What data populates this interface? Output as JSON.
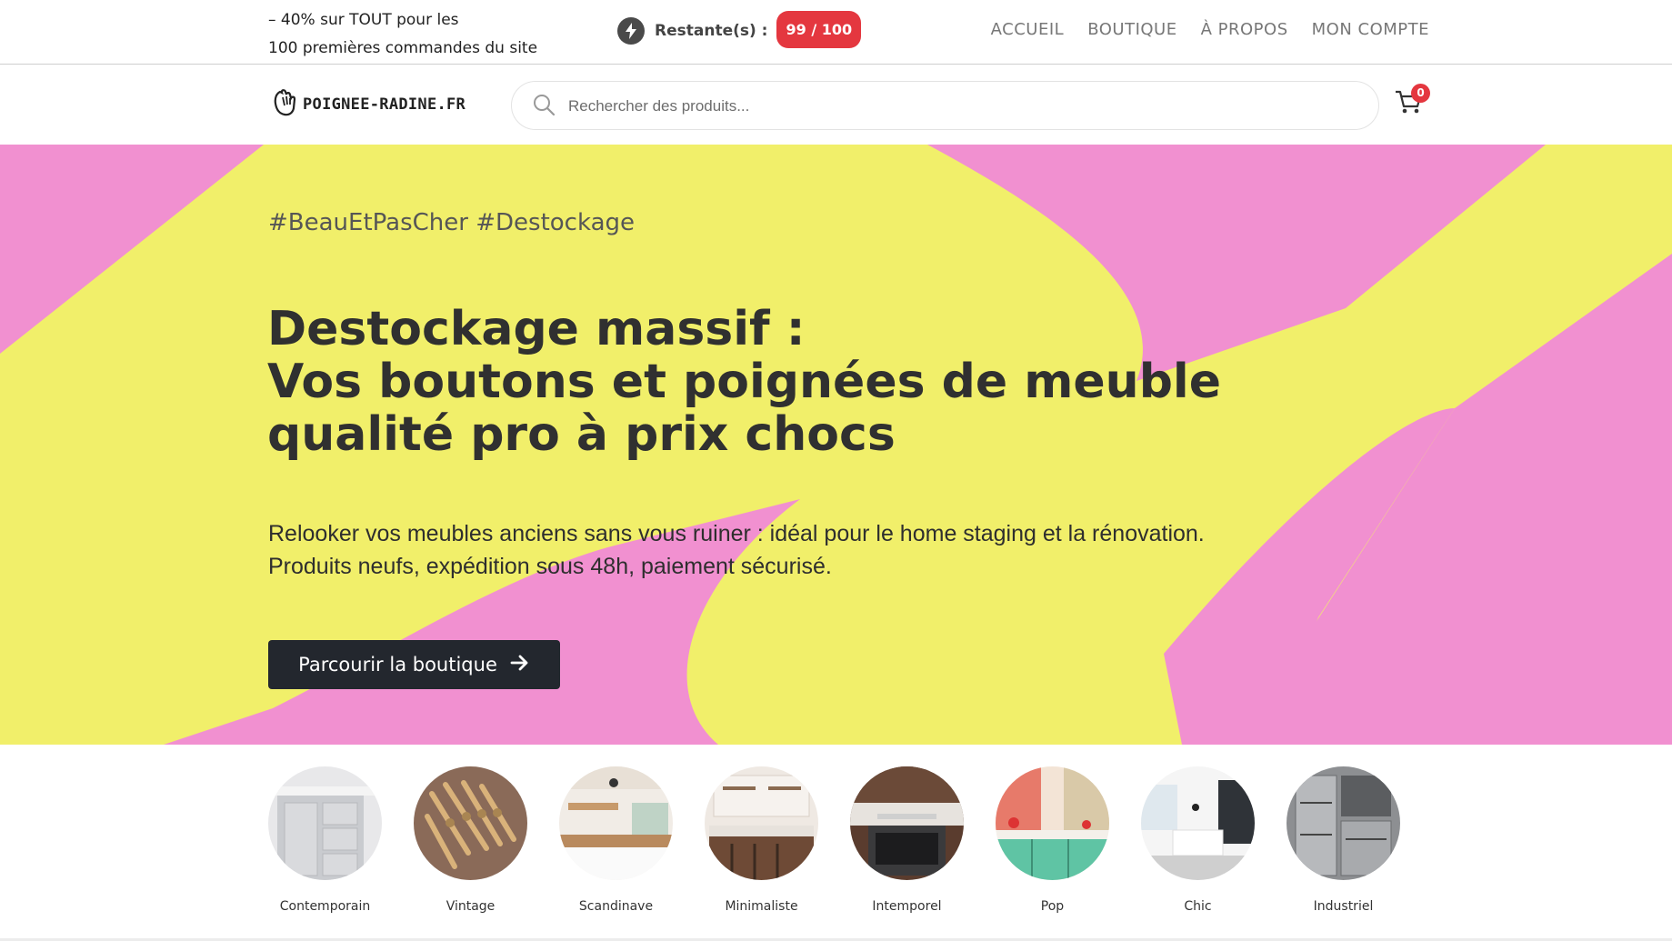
{
  "promo": {
    "line1": "– 40% sur TOUT pour les",
    "line2": "100 premières commandes du site"
  },
  "counter": {
    "label": "Restante(s) :",
    "value": "99 / 100",
    "icon": "lightning-icon"
  },
  "nav": {
    "items": [
      "ACCUEIL",
      "BOUTIQUE",
      "À PROPOS",
      "MON COMPTE"
    ]
  },
  "logo": {
    "text": "POIGNEE-RADINE.FR"
  },
  "search": {
    "placeholder": "Rechercher des produits...",
    "value": ""
  },
  "cart": {
    "count": "0"
  },
  "hero": {
    "hashtags": "#BeauEtPasCher #Destockage",
    "headline": [
      "Destockage massif :",
      "Vos boutons et poignées de meuble",
      "qualité pro à prix chocs"
    ],
    "subtitle": [
      "Relooker vos meubles anciens sans vous ruiner : idéal pour le home staging et la rénovation.",
      "Produits neufs, expédition sous 48h, paiement sécurisé."
    ],
    "cta": "Parcourir la boutique"
  },
  "categories": [
    "Contemporain",
    "Vintage",
    "Scandinave",
    "Minimaliste",
    "Intemporel",
    "Pop",
    "Chic",
    "Industriel"
  ],
  "colors": {
    "pink": "#f190d0",
    "yellow": "#f1ef6a",
    "badge_red": "#e4373f",
    "dark_button": "#23272e"
  }
}
